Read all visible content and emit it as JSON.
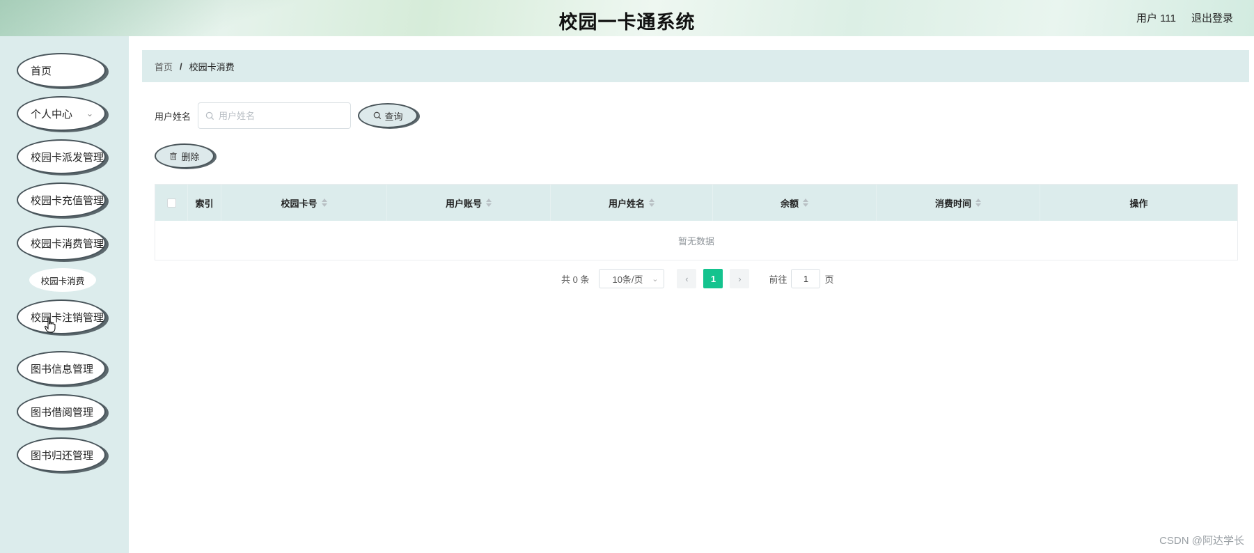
{
  "header": {
    "title": "校园一卡通系统",
    "user_label": "用户 111",
    "logout_label": "退出登录"
  },
  "sidebar": {
    "items": [
      {
        "label": "首页"
      },
      {
        "label": "个人中心",
        "has_chevron": true
      },
      {
        "label": "校园卡派发管理"
      },
      {
        "label": "校园卡充值管理"
      },
      {
        "label": "校园卡消费管理"
      },
      {
        "label": "校园卡注销管理"
      },
      {
        "label": "图书信息管理"
      },
      {
        "label": "图书借阅管理"
      },
      {
        "label": "图书归还管理"
      }
    ],
    "sub_item": {
      "label": "校园卡消费"
    }
  },
  "breadcrumb": {
    "home": "首页",
    "separator": "/",
    "current": "校园卡消费"
  },
  "search": {
    "label": "用户姓名",
    "placeholder": "用户姓名",
    "value": "",
    "button_label": "查询"
  },
  "toolbar": {
    "delete_label": "删除"
  },
  "table": {
    "columns": [
      {
        "label": "索引",
        "sortable": false
      },
      {
        "label": "校园卡号",
        "sortable": true
      },
      {
        "label": "用户账号",
        "sortable": true
      },
      {
        "label": "用户姓名",
        "sortable": true
      },
      {
        "label": "余额",
        "sortable": true
      },
      {
        "label": "消费时间",
        "sortable": true
      },
      {
        "label": "操作",
        "sortable": false
      }
    ],
    "rows": [],
    "empty_text": "暂无数据"
  },
  "pagination": {
    "total_text": "共 0 条",
    "page_size": "10条/页",
    "current_page": "1",
    "goto_label": "前往",
    "goto_value": "1",
    "page_suffix": "页"
  },
  "watermark": "CSDN @阿达学长",
  "colors": {
    "accent": "#14c38e",
    "panel": "#dcecec",
    "pill_border": "#48545a"
  }
}
